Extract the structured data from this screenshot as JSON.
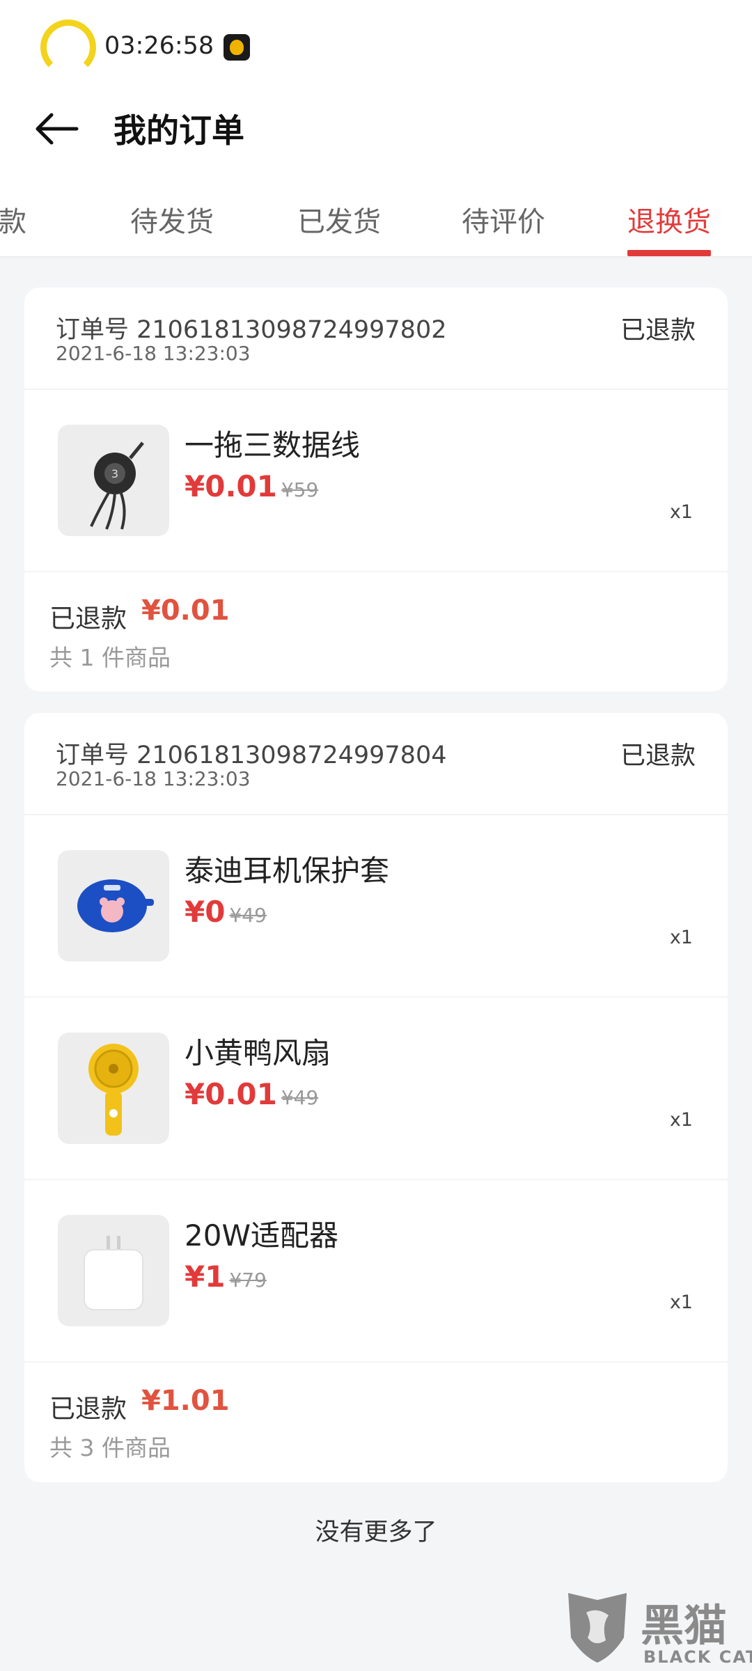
{
  "status_bar": {
    "time": "03:26:58"
  },
  "header": {
    "title": "我的订单"
  },
  "tabs": [
    {
      "label": "付款"
    },
    {
      "label": "待发货"
    },
    {
      "label": "已发货"
    },
    {
      "label": "待评价"
    },
    {
      "label": "退换货",
      "active": true
    }
  ],
  "orders": [
    {
      "order_label": "订单号 21061813098724997802",
      "date": "2021-6-18 13:23:03",
      "status": "已退款",
      "items": [
        {
          "name": "一拖三数据线",
          "price": "¥0.01",
          "original_price": "¥59",
          "qty": "x1",
          "image": "cable-icon"
        }
      ],
      "refund_label": "已退款",
      "refund_amount": "¥0.01",
      "count_text": "共 1 件商品"
    },
    {
      "order_label": "订单号 21061813098724997804",
      "date": "2021-6-18 13:23:03",
      "status": "已退款",
      "items": [
        {
          "name": "泰迪耳机保护套",
          "price": "¥0",
          "original_price": "¥49",
          "qty": "x1",
          "image": "earbud-case-icon"
        },
        {
          "name": "小黄鸭风扇",
          "price": "¥0.01",
          "original_price": "¥49",
          "qty": "x1",
          "image": "fan-icon"
        },
        {
          "name": "20W适配器",
          "price": "¥1",
          "original_price": "¥79",
          "qty": "x1",
          "image": "adapter-icon"
        }
      ],
      "refund_label": "已退款",
      "refund_amount": "¥1.01",
      "count_text": "共 3 件商品"
    }
  ],
  "footer": {
    "no_more": "没有更多了"
  },
  "watermark": {
    "cn": "黑猫",
    "en": "BLACK CAT"
  },
  "colors": {
    "accent": "#e23a3a",
    "refund": "#e0533f",
    "background": "#f4f5f7"
  }
}
